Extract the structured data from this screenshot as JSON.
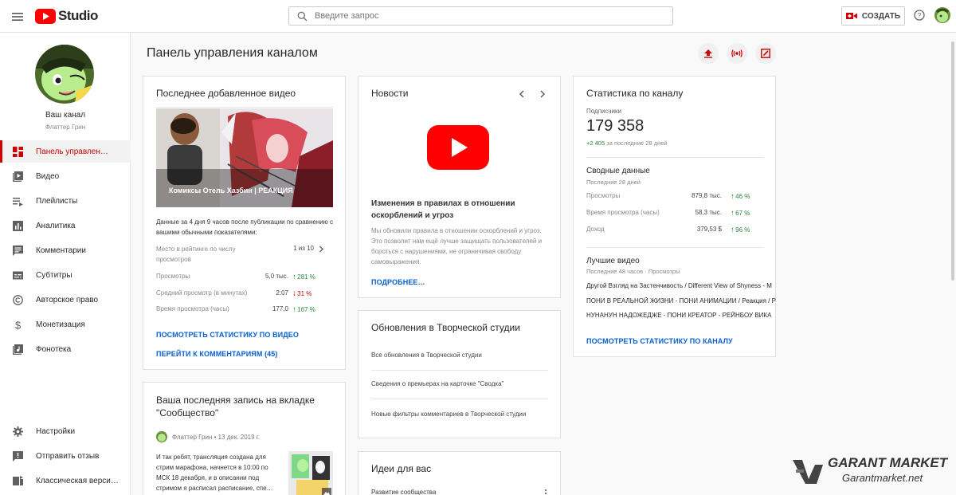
{
  "topbar": {
    "logo_text": "Studio",
    "search_placeholder": "Введите запрос",
    "create_label": "СОЗДАТЬ"
  },
  "sidebar": {
    "channel_label": "Ваш канал",
    "channel_name": "Флаттер Грин",
    "items": [
      {
        "label": "Панель управлен…",
        "icon": "dashboard-icon",
        "active": true
      },
      {
        "label": "Видео",
        "icon": "video-icon"
      },
      {
        "label": "Плейлисты",
        "icon": "playlist-icon"
      },
      {
        "label": "Аналитика",
        "icon": "analytics-icon"
      },
      {
        "label": "Комментарии",
        "icon": "comments-icon"
      },
      {
        "label": "Субтитры",
        "icon": "subtitles-icon"
      },
      {
        "label": "Авторское право",
        "icon": "copyright-icon"
      },
      {
        "label": "Монетизация",
        "icon": "dollar-icon"
      },
      {
        "label": "Фонотека",
        "icon": "audio-library-icon"
      }
    ],
    "bottom_items": [
      {
        "label": "Настройки",
        "icon": "gear-icon"
      },
      {
        "label": "Отправить отзыв",
        "icon": "feedback-icon"
      },
      {
        "label": "Классическая верси…",
        "icon": "classic-icon"
      }
    ]
  },
  "page": {
    "title": "Панель управления каналом"
  },
  "latest_video": {
    "title": "Последнее добавленное видео",
    "video_title": "Комиксы Отель Хазбин | РЕАКЦИЯ",
    "summary": "Данные за 4 дня 9 часов после публикации по сравнению с вашими обычными показателями:",
    "rank_label": "Место в рейтинге по числу просмотров",
    "rank_value": "1 из 10",
    "stats": [
      {
        "label": "Просмотры",
        "value": "5,0 тыс.",
        "delta": "281 %",
        "dir": "up"
      },
      {
        "label": "Средний просмотр (в минутах)",
        "value": "2:07",
        "delta": "31 %",
        "dir": "down"
      },
      {
        "label": "Время просмотра (часы)",
        "value": "177,0",
        "delta": "167 %",
        "dir": "up"
      }
    ],
    "link_stats": "ПОСМОТРЕТЬ СТАТИСТИКУ ПО ВИДЕО",
    "link_comments": "ПЕРЕЙТИ К КОММЕНТАРИЯМ (45)"
  },
  "community": {
    "title": "Ваша последняя запись на вкладке \"Сообщество\"",
    "author": "Флаттер Грин",
    "date": "13 дек. 2019 г.",
    "text": "И так ребят, трансляция создана для стрим марафона, начнется в 10:00 по МСК 18 декабря, и в описании под стримом я расписал расписание, спе…"
  },
  "news": {
    "title": "Новости",
    "headline": "Изменения в правилах в отношении оскорблений и угроз",
    "body": "Мы обновили правила в отношении оскорблений и угроз. Это позволит нам ещё лучше защищать пользователей и бороться с нарушениями, не ограничивая свободу самовыражения.",
    "link": "ПОДРОБНЕЕ…"
  },
  "studio_updates": {
    "title": "Обновления в Творческой студии",
    "items": [
      "Все обновления в Творческой студии",
      "Сведения о премьерах на карточке \"Сводка\"",
      "Новые фильтры комментариев в Творческой студии"
    ]
  },
  "ideas": {
    "title": "Идеи для вас",
    "first_item": "Развитие сообщества"
  },
  "channel_stats": {
    "title": "Статистика по каналу",
    "subs_label": "Подписчики",
    "subs_value": "179 358",
    "subs_delta": "+2 405",
    "subs_delta_period": "за последние 28 дней",
    "summary_title": "Сводные данные",
    "summary_period": "Последние 28 дней",
    "rows": [
      {
        "label": "Просмотры",
        "value": "879,8 тыс.",
        "delta": "46 %",
        "dir": "up"
      },
      {
        "label": "Время просмотра (часы)",
        "value": "58,3 тыс.",
        "delta": "67 %",
        "dir": "up"
      },
      {
        "label": "Доход",
        "value": "379,53 $",
        "delta": "96 %",
        "dir": "up"
      }
    ],
    "top_title": "Лучшие видео",
    "top_period": "Последние 48 часов · Просмотры",
    "top_videos": [
      "Другой Взгляд на Застенчивость / Different View of Shyness - М",
      "ПОНИ В РЕАЛЬНОЙ ЖИЗНИ - ПОНИ АНИМАЦИИ / Реакция / Р",
      "НУНАНУН НАДОЖЕДЖЕ - ПОНИ КРЕАТОР - РЕЙНБОУ ВИКА"
    ],
    "link": "ПОСМОТРЕТЬ СТАТИСТИКУ ПО КАНАЛУ"
  },
  "watermark": {
    "title": "GARANT MARKET",
    "subtitle": "Garantmarket.net"
  },
  "colors": {
    "brand_red": "#ff0000",
    "accent_red": "#cc0000",
    "link_blue": "#065fd4",
    "positive_green": "#2b8a3e"
  }
}
